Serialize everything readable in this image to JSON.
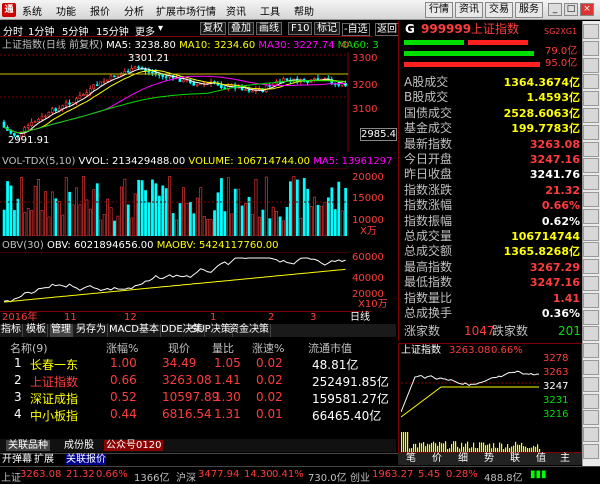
{
  "menu": [
    "系统",
    "功能",
    "报价",
    "分析",
    "扩展市场行情",
    "资讯",
    "工具",
    "帮助"
  ],
  "menu_right": [
    "行情",
    "资讯",
    "交易",
    "服务"
  ],
  "toolbar": {
    "periods": [
      "分时",
      "1分钟",
      "5分钟",
      "15分钟",
      "更多"
    ],
    "buttons": [
      "复权",
      "叠加",
      "画线",
      "F10",
      "标记",
      "-自选",
      "返回"
    ]
  },
  "chart_header": {
    "title": "上证指数(日线 前复权)",
    "ma5": "MA5: 3238.80",
    "ma10": "MA10: 3234.60",
    "ma30": "MA30: 3227.74",
    "ma60": "MA60: 3"
  },
  "price_axis": [
    "3300",
    "3200",
    "3100"
  ],
  "price_axis_current": "2985.4",
  "peak_label": "3301.21",
  "low_label": "2991.91",
  "vol_header": {
    "title": "VOL-TDX(5,10)",
    "vvol": "VVOL: 213429488.00",
    "volume": "VOLUME: 106714744.00",
    "ma5": "MA5: 13961297"
  },
  "vol_axis": [
    "20000",
    "15000",
    "10000"
  ],
  "vol_unit": "X万",
  "obv_header": {
    "title": "OBV(30)",
    "obv": "OBV: 6021894656.00",
    "maobv": "MAOBV: 5424117760.00"
  },
  "obv_axis": [
    "60000",
    "40000",
    "20000"
  ],
  "obv_unit": "X10万",
  "date_axis": {
    "year": "2016年",
    "marks": [
      "11",
      "12",
      "1",
      "2",
      "3"
    ],
    "period": "日线"
  },
  "indicator_tabs": [
    "指标",
    "模板",
    "管理",
    "另存为",
    "MACD基本",
    "DDE决策",
    "SUP决策",
    "资金决策"
  ],
  "table": {
    "headers": [
      "名称(9)",
      "涨幅%",
      "现价",
      "量比",
      "涨速%",
      "流通市值"
    ],
    "rows": [
      {
        "idx": "1",
        "name": "长春一东",
        "chg": "1.00",
        "price": "34.49",
        "qr": "1.05",
        "spd": "0.02",
        "cap": "48.81亿"
      },
      {
        "idx": "2",
        "name": "上证指数",
        "chg": "0.66",
        "price": "3263.08",
        "qr": "1.41",
        "spd": "0.02",
        "cap": "252491.85亿"
      },
      {
        "idx": "3",
        "name": "深证成指",
        "chg": "0.52",
        "price": "10597.89",
        "qr": "1.30",
        "spd": "0.02",
        "cap": "159581.27亿"
      },
      {
        "idx": "4",
        "name": "中小板指",
        "chg": "0.44",
        "price": "6816.54",
        "qr": "1.31",
        "spd": "0.01",
        "cap": "66465.40亿"
      }
    ]
  },
  "bottom_tabs": [
    "关联品种",
    "成份股",
    "公众号0120"
  ],
  "bottom_tabs2": [
    "开弹幕",
    "扩展",
    "关联报价"
  ],
  "quote": {
    "code": "999999",
    "name": "上证指数",
    "badge": "SG2XG1",
    "bar1": "79.0亿",
    "bar2": "95.0亿",
    "rows": [
      {
        "k": "A股成交",
        "v": "1364.3674亿",
        "c": "yel"
      },
      {
        "k": "B股成交",
        "v": "1.4593亿",
        "c": "yel"
      },
      {
        "k": "国债成交",
        "v": "2528.6063亿",
        "c": "yel"
      },
      {
        "k": "基金成交",
        "v": "199.7783亿",
        "c": "yel"
      },
      {
        "k": "最新指数",
        "v": "3263.08",
        "c": "red"
      },
      {
        "k": "今日开盘",
        "v": "3247.16",
        "c": "red"
      },
      {
        "k": "昨日收盘",
        "v": "3241.76",
        "c": "wht"
      },
      {
        "k": "指数涨跌",
        "v": "21.32",
        "c": "red"
      },
      {
        "k": "指数涨幅",
        "v": "0.66%",
        "c": "red"
      },
      {
        "k": "指数振幅",
        "v": "0.62%",
        "c": "wht"
      },
      {
        "k": "总成交量",
        "v": "106714744",
        "c": "yel"
      },
      {
        "k": "总成交额",
        "v": "1365.8268亿",
        "c": "yel"
      },
      {
        "k": "最高指数",
        "v": "3267.29",
        "c": "red"
      },
      {
        "k": "最低指数",
        "v": "3247.16",
        "c": "red"
      },
      {
        "k": "指数量比",
        "v": "1.41",
        "c": "red"
      },
      {
        "k": "总成换手",
        "v": "0.36%",
        "c": "wht"
      }
    ],
    "up_label": "涨家数",
    "up": "1047",
    "down_label": "跌家数",
    "down": "201"
  },
  "mini": {
    "title": "上证指数",
    "price": "3263.08",
    "pct": "0.66%",
    "axis": [
      "3278",
      "3263",
      "3247",
      "3231",
      "3216"
    ],
    "tabs": [
      "笔",
      "价",
      "细",
      "势",
      "联",
      "值",
      "主"
    ]
  },
  "status": {
    "sh_name": "上证",
    "sh": "3263.08",
    "sh_chg": "21.32",
    "sh_pct": "0.66%",
    "sh_amt": "1366亿",
    "hs_name": "沪深",
    "hs": "3477.94",
    "hs_chg": "14.30",
    "hs_pct": "0.41%",
    "hs_amt": "730.0亿",
    "cy_name": "创业",
    "cy": "1963.27",
    "cy_chg": "5.45",
    "cy_pct": "0.28%",
    "cy_amt": "488.8亿"
  },
  "colors": {
    "up": "#ff3c3c",
    "down": "#00ffff",
    "ma5": "#ffffff",
    "ma10": "#ffff00",
    "ma30": "#ff00ff",
    "ma60": "#00e000"
  }
}
